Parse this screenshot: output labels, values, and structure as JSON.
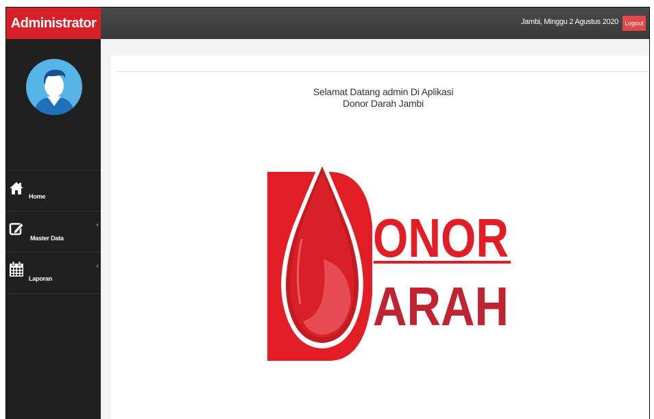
{
  "brand": {
    "title": "Administrator"
  },
  "topbar": {
    "date_text": "Jambi, Minggu 2 Agustus 2020",
    "logout_label": "Logout"
  },
  "sidebar": {
    "items": [
      {
        "label": "Home",
        "icon": "home-icon",
        "has_submenu": false
      },
      {
        "label": "Master Data",
        "icon": "edit-icon",
        "has_submenu": true
      },
      {
        "label": "Laporan",
        "icon": "calendar-icon",
        "has_submenu": true
      }
    ],
    "chevron": "‹"
  },
  "main": {
    "welcome_line1": "Selamat Datang admin Di Aplikasi",
    "welcome_line2": "Donor Darah Jambi",
    "logo": {
      "word1": "ONOR",
      "word2": "ARAH"
    }
  },
  "colors": {
    "brand_red": "#d61f26",
    "topbar": "#3f3f3f",
    "sidebar": "#202020",
    "logo_red": "#e21d25",
    "logo_dark_red": "#bf2430"
  }
}
